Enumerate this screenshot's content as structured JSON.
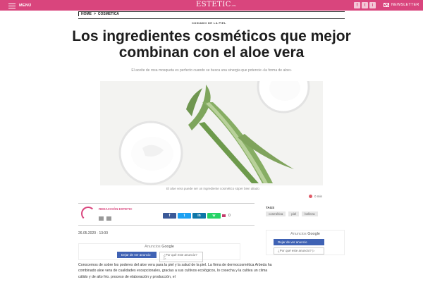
{
  "header": {
    "menu_label": "MENÚ",
    "logo_main": "ESTETIC",
    "logo_suffix": ".es",
    "social_icons": [
      "facebook-icon",
      "twitter-icon",
      "instagram-icon"
    ],
    "social_glyphs": [
      "f",
      "t",
      "i"
    ],
    "newsletter_label": "NEWSLETTER",
    "brand_color": "#d9457d"
  },
  "breadcrumb": {
    "home": "HOME",
    "separator": ">",
    "section": "COSMÉTICA"
  },
  "article": {
    "kicker": "CUIDADO DE LA PIEL",
    "title": "Los ingredientes cosméticos que mejor combinan con el aloe vera",
    "subtitle": "El aceite de rosa mosqueta es perfecto cuando se busca una sinergia que potencie «la forma de aloe»",
    "image_caption": "El aloe vera puede ser un ingrediente cosmético súper bien aliado",
    "comments_count": "0 min",
    "author": "REDACCIÓN ESTETIC",
    "share_counter": "0",
    "date_time": "26.05.2020 · 13:00",
    "body_text": "Conocemos de sobre los poderes del aloe vera para la piel y la salud de la piel. La firma de dermocosmética Arbeda ha combinado aloe vera de cualidades excepcionales, gracias a sus cultivos ecológicos, lo cosecha y la cultiva un clima cálido y de alto frio. proceso de elaboración y producción, el"
  },
  "tags": {
    "title": "TAGS",
    "items": [
      "cosmética",
      "piel",
      "belleza"
    ]
  },
  "share_buttons": [
    {
      "name": "facebook-share-button",
      "label": "f",
      "color": "#3b5998"
    },
    {
      "name": "twitter-share-button",
      "label": "t",
      "color": "#1da1f2"
    },
    {
      "name": "linkedin-share-button",
      "label": "in",
      "color": "#0e76a8"
    },
    {
      "name": "whatsapp-share-button",
      "label": "w",
      "color": "#25d366"
    }
  ],
  "ads": {
    "left": {
      "header_prefix": "Anuncios",
      "header_brand": "Google",
      "cta": "Dejar de ver anuncio",
      "question": "¿Por qué este anuncio? ▷"
    },
    "right": {
      "header_prefix": "Anuncios",
      "header_brand": "Google",
      "cta": "Dejar de ver anuncio",
      "question": "¿Por qué este anuncio? ▷"
    }
  }
}
